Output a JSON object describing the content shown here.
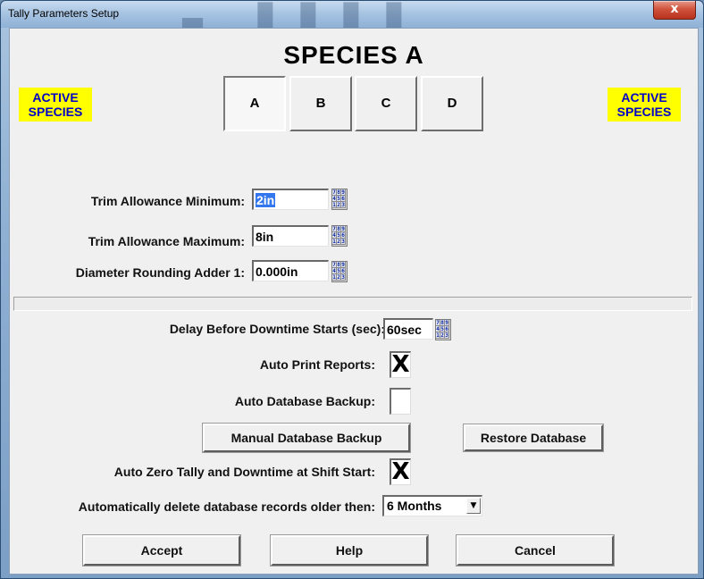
{
  "window": {
    "title": "Tally Parameters Setup",
    "close_label": "x"
  },
  "heading": "SPECIES A",
  "active_badge": "ACTIVE SPECIES",
  "species_tabs": [
    {
      "label": "A",
      "selected": true
    },
    {
      "label": "B",
      "selected": false
    },
    {
      "label": "C",
      "selected": false
    },
    {
      "label": "D",
      "selected": false
    }
  ],
  "fields": {
    "trim_min": {
      "label": "Trim Allowance Minimum:",
      "value": "2in"
    },
    "trim_max": {
      "label": "Trim Allowance Maximum:",
      "value": "8in"
    },
    "diameter_adder": {
      "label": "Diameter Rounding Adder 1:",
      "value": "0.000in"
    },
    "downtime_delay": {
      "label": "Delay Before Downtime Starts (sec):",
      "value": "60sec"
    }
  },
  "keypad_digits": [
    "7",
    "8",
    "9",
    "4",
    "5",
    "6",
    "1",
    "2",
    "3"
  ],
  "checkboxes": {
    "auto_print": {
      "label": "Auto Print Reports:",
      "checked": true
    },
    "auto_backup": {
      "label": "Auto Database Backup:",
      "checked": false
    },
    "auto_zero": {
      "label": "Auto Zero Tally and Downtime at Shift Start:",
      "checked": true
    }
  },
  "buttons": {
    "manual_backup": "Manual Database Backup",
    "restore": "Restore Database",
    "accept": "Accept",
    "help": "Help",
    "cancel": "Cancel"
  },
  "auto_delete": {
    "label": "Automatically delete database records older then:",
    "value": "6 Months"
  },
  "check_mark": "X"
}
